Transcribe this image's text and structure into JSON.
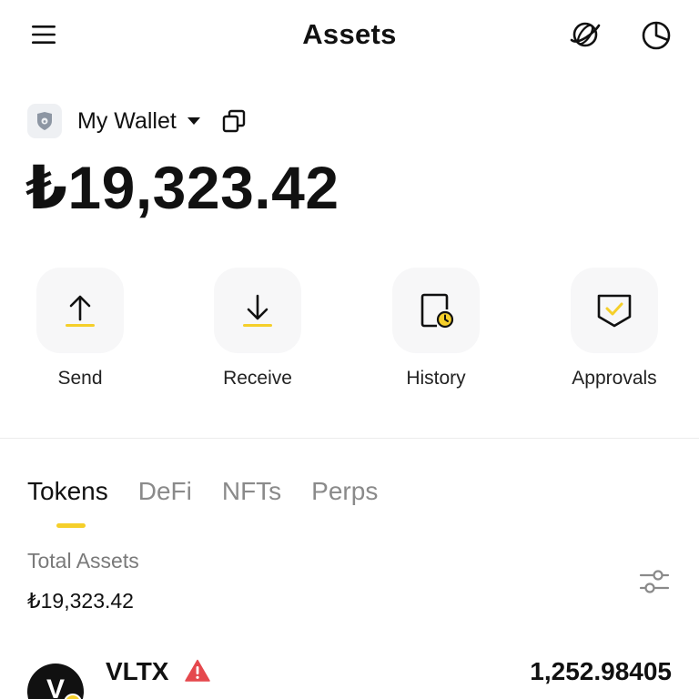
{
  "header": {
    "title": "Assets",
    "menu_icon": "hamburger-menu-icon",
    "network_icon": "globe-planet-icon",
    "portfolio_icon": "pie-chart-icon"
  },
  "wallet": {
    "avatar_icon": "bear-shield-icon",
    "name": "My Wallet",
    "dropdown_icon": "caret-down-icon",
    "copy_icon": "copy-icon",
    "balance": "₺19,323.42"
  },
  "actions": [
    {
      "label": "Send",
      "icon": "arrow-up-icon"
    },
    {
      "label": "Receive",
      "icon": "arrow-down-icon"
    },
    {
      "label": "History",
      "icon": "history-clock-icon"
    },
    {
      "label": "Approvals",
      "icon": "shield-check-icon"
    }
  ],
  "tabs": [
    {
      "label": "Tokens",
      "active": true
    },
    {
      "label": "DeFi",
      "active": false
    },
    {
      "label": "NFTs",
      "active": false
    },
    {
      "label": "Perps",
      "active": false
    }
  ],
  "summary": {
    "total_label": "Total Assets",
    "total_value": "₺19,323.42",
    "filter_icon": "sliders-filter-icon"
  },
  "tokens": [
    {
      "symbol": "VLTX",
      "logo_letter": "V",
      "warning": true,
      "amount": "1,252.98405"
    }
  ],
  "colors": {
    "accent": "#f5cf2a",
    "warning": "#e5484d",
    "text_primary": "#111111",
    "text_secondary": "#8a8a8a",
    "tile_bg": "#f7f7f8"
  }
}
